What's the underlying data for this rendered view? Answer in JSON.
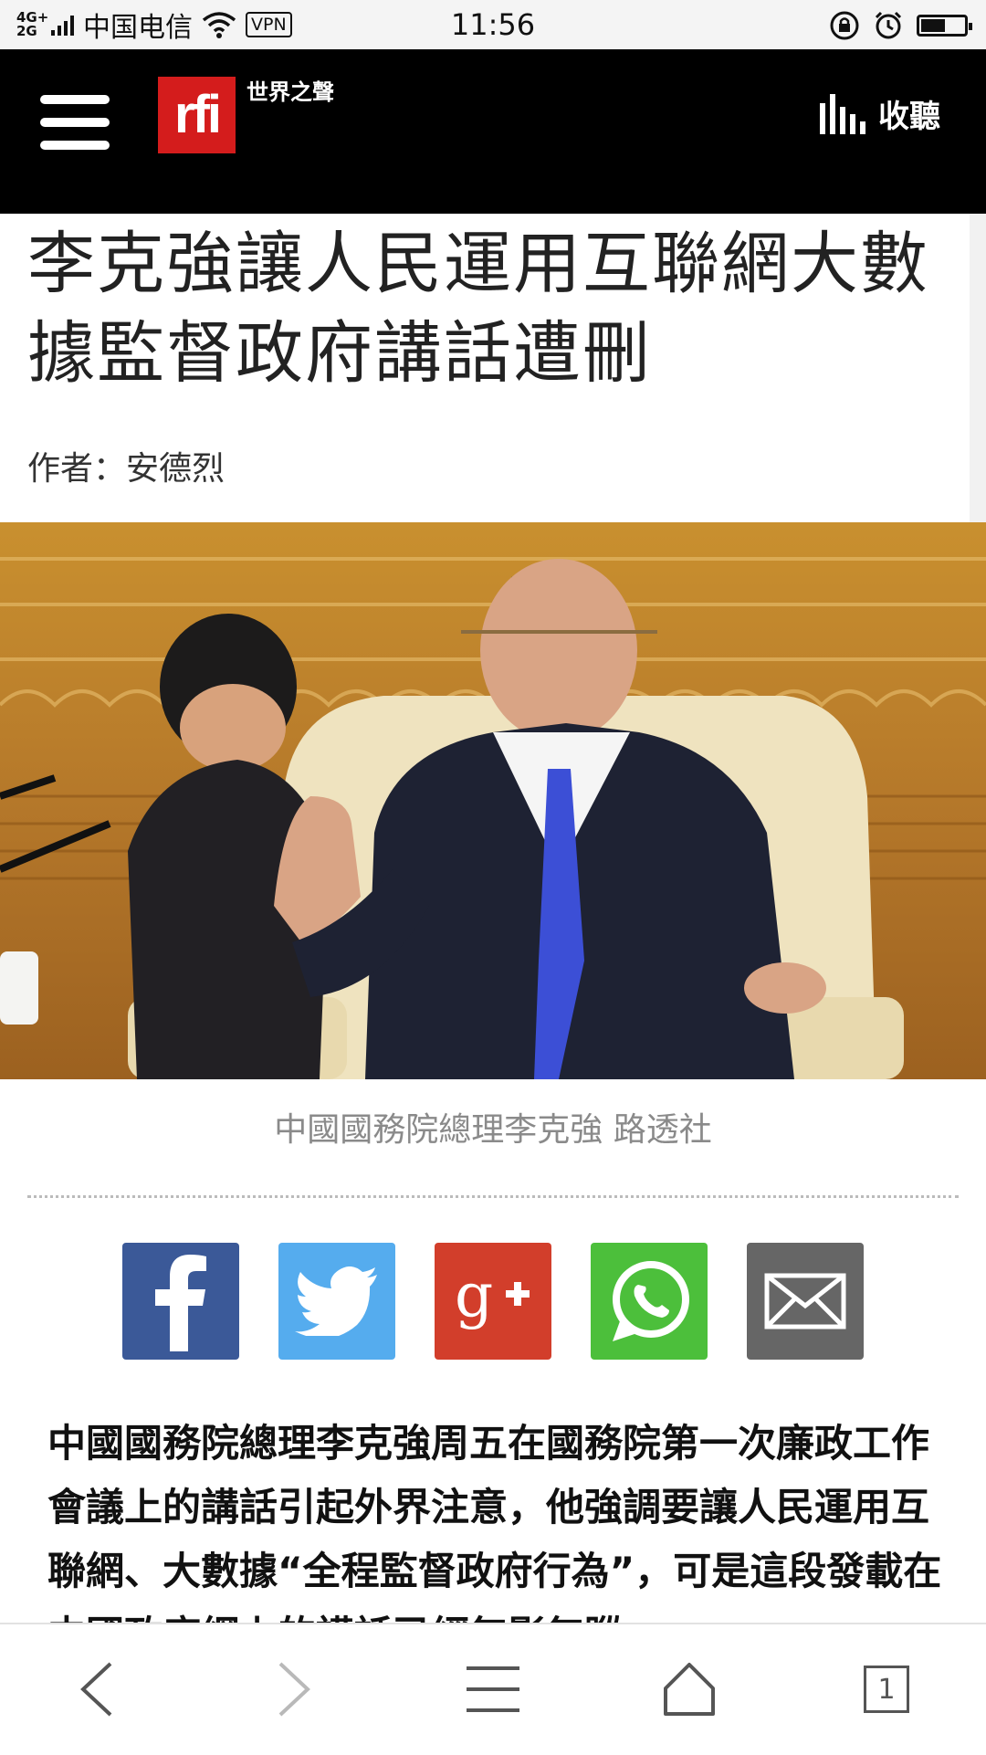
{
  "status_bar": {
    "network": "4G+ 2G",
    "carrier": "中国电信",
    "vpn": "VPN",
    "time": "11:56",
    "battery_level": 0.6
  },
  "header": {
    "logo_text": "rfi",
    "brand_subtitle": "世界之聲",
    "listen_label": "收聽"
  },
  "article": {
    "title": "李克強讓人民運用互聯網大數據監督政府講話遭刪",
    "byline": "作者：安德烈",
    "photo_caption": "中國國務院總理李克強 路透社",
    "body": "中國國務院總理李克強周五在國務院第一次廉政工作會議上的講話引起外界注意，他強調要讓人民運用互聯網、大數據“全程監督政府行為”，可是這段發載在中國政府網上的講話已經無影無蹤"
  },
  "share": {
    "items": [
      "facebook",
      "twitter",
      "google-plus",
      "whatsapp",
      "email"
    ]
  },
  "bottom_nav": {
    "tab_count": "1"
  },
  "colors": {
    "header_bg": "#000000",
    "rfi_red": "#d41c1c",
    "facebook": "#3b5998",
    "twitter": "#55acee",
    "google_plus": "#d23e2b",
    "whatsapp": "#4cbf3b",
    "email": "#666666"
  }
}
